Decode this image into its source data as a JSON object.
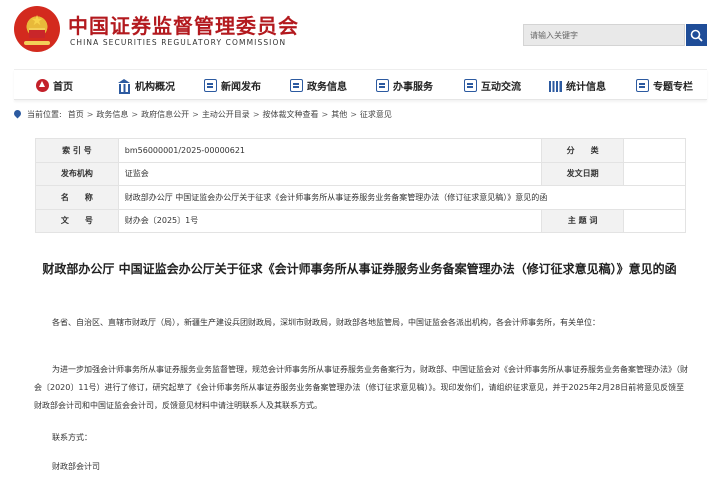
{
  "header": {
    "title": "中国证券监督管理委员会",
    "subtitle": "CHINA SECURITIES REGULATORY COMMISSION",
    "search_placeholder": "请输入关键字"
  },
  "nav": {
    "items": [
      {
        "label": "首页",
        "icon": "home-icon"
      },
      {
        "label": "机构概况",
        "icon": "building-icon"
      },
      {
        "label": "新闻发布",
        "icon": "news-icon"
      },
      {
        "label": "政务信息",
        "icon": "monitor-icon"
      },
      {
        "label": "办事服务",
        "icon": "document-icon"
      },
      {
        "label": "互动交流",
        "icon": "chat-icon"
      },
      {
        "label": "统计信息",
        "icon": "bar-chart-icon"
      },
      {
        "label": "专题专栏",
        "icon": "column-icon"
      }
    ]
  },
  "breadcrumb": {
    "prefix": "当前位置:",
    "items": [
      "首页",
      "政务信息",
      "政府信息公开",
      "主动公开目录",
      "按体裁文种查看",
      "其他",
      "征求意见"
    ],
    "separator": ">"
  },
  "meta": {
    "index_label": "索 引 号",
    "index_value": "bm56000001/2025-00000621",
    "category_label": "分　　类",
    "category_value": "",
    "issuer_label": "发布机构",
    "issuer_value": "证监会",
    "date_label": "发文日期",
    "date_value": "",
    "name_label": "名　　称",
    "name_value": "财政部办公厅 中国证监会办公厅关于征求《会计师事务所从事证券服务业务备案管理办法（修订征求意见稿）》意见的函",
    "docno_label": "文　　号",
    "docno_value": "财办会〔2025〕1号",
    "subject_label": "主 题 词",
    "subject_value": ""
  },
  "document": {
    "title": "财政部办公厅 中国证监会办公厅关于征求《会计师事务所从事证券服务业务备案管理办法（修订征求意见稿）》意见的函",
    "addressee": "各省、自治区、直辖市财政厅（局），新疆生产建设兵团财政局，深圳市财政局，财政部各地监管局，中国证监会各派出机构，各会计师事务所，有关单位：",
    "body": "为进一步加强会计师事务所从事证券服务业务监督管理，规范会计师事务所从事证券服务业务备案行为，财政部、中国证监会对《会计师事务所从事证券服务业务备案管理办法》（财会〔2020〕11号）进行了修订，研究起草了《会计师事务所从事证券服务业务备案管理办法（修订征求意见稿）》。现印发你们，请组织征求意见，并于2025年2月28日前将意见反馈至财政部会计司和中国证监会会计司，反馈意见材料中请注明联系人及其联系方式。",
    "contact_label": "联系方式：",
    "contact_dept": "财政部会计司"
  },
  "colors": {
    "brand_red": "#b3191e",
    "nav_blue": "#2c5aa0",
    "search_button": "#1f4d98"
  }
}
